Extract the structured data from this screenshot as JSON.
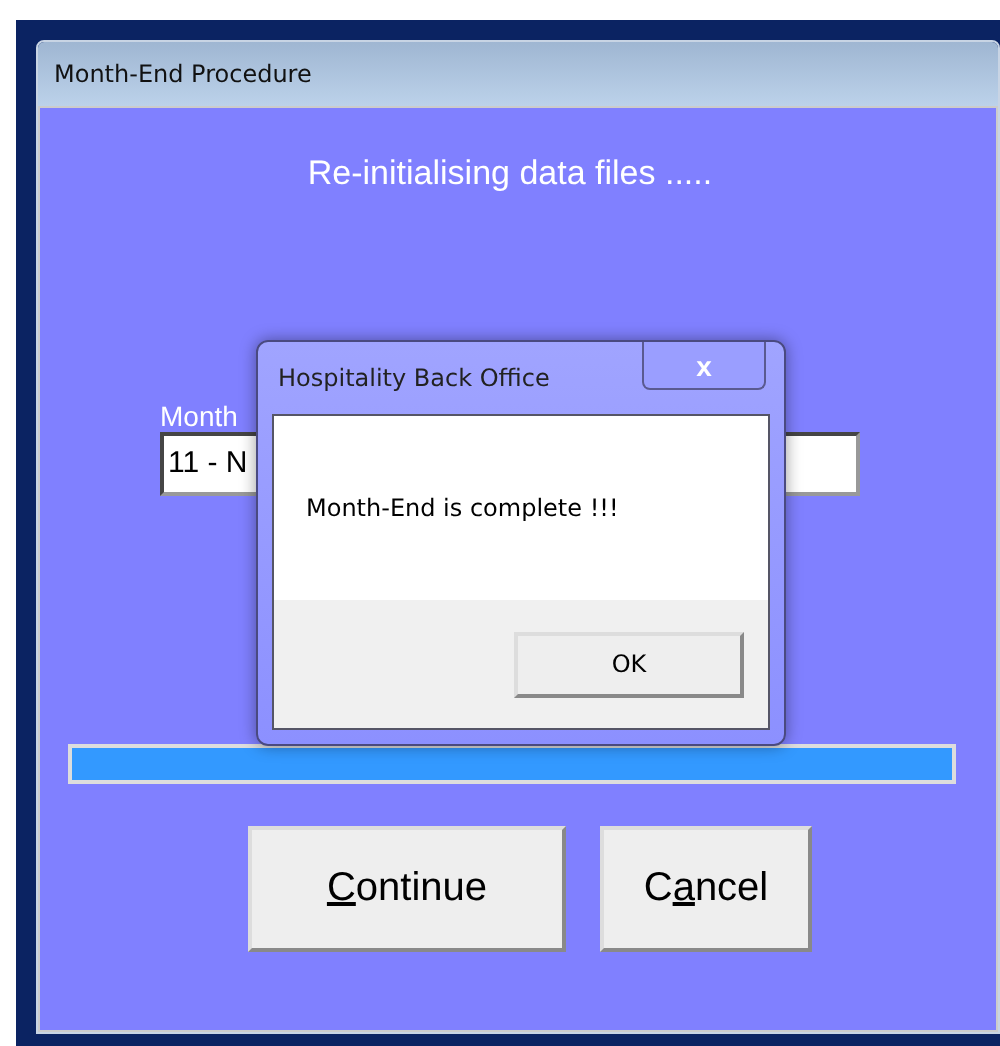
{
  "window": {
    "title": "Month-End Procedure"
  },
  "status_text": "Re-initialising data files .....",
  "field": {
    "label": "Month",
    "value": "11 - N"
  },
  "progress": {
    "level": 1
  },
  "buttons": [
    {
      "access_key": "C",
      "label_rest": "ontinue"
    },
    {
      "label_start": "C",
      "access_key": "a",
      "label_rest": "ncel"
    }
  ],
  "dialog": {
    "title": "Hospitality Back Office",
    "close": "x",
    "message": "Month-End is complete !!!",
    "button": "OK"
  }
}
